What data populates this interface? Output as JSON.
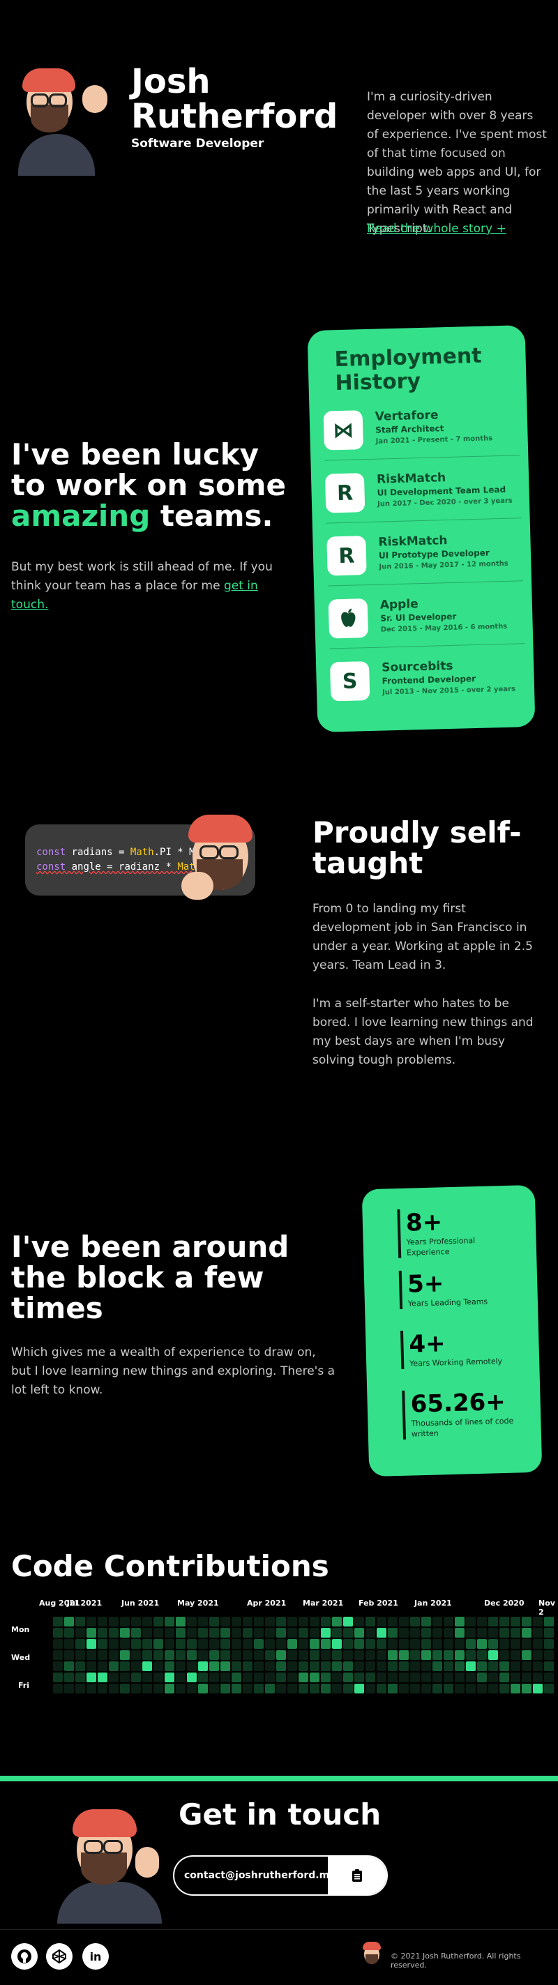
{
  "hero": {
    "first_name": "Josh",
    "last_name": "Rutherford",
    "subtitle": "Software Developer",
    "bio": "I'm a curiosity-driven developer with over 8 years of experience. I've spent most of that time focused on building web apps and UI, for the last 5 years working primarily with React and Typescript.",
    "story_link": "Read the whole story +"
  },
  "teams": {
    "line1": "I've been lucky",
    "line2": "to work on some",
    "highlight": "amazing",
    "line3_rest": " teams.",
    "body": "But my best work is still ahead of me. If you think your team has a place for me ",
    "cta": "get in touch."
  },
  "employment": {
    "title_line1": "Employment",
    "title_line2": "History",
    "jobs": [
      {
        "logo": "⋈",
        "company": "Vertafore",
        "role": "Staff Architect",
        "dates": "Jan 2021 - Present - 7 months"
      },
      {
        "logo": "R",
        "company": "RiskMatch",
        "role": "UI Development Team Lead",
        "dates": "Jun 2017 - Dec 2020 - over 3 years"
      },
      {
        "logo": "R",
        "company": "RiskMatch",
        "role": "UI Prototype Developer",
        "dates": "Jun 2016 - May 2017 - 12 months"
      },
      {
        "logo": "",
        "company": "Apple",
        "role": "Sr. UI Developer",
        "dates": "Dec 2015 - May 2016 - 6 months"
      },
      {
        "logo": "S",
        "company": "Sourcebits",
        "role": "Frontend Developer",
        "dates": "Jul 2013 - Nov 2015 - over 2 years"
      }
    ]
  },
  "selftaught": {
    "line1": "Proudly self-",
    "line2": "taught",
    "para1": "From 0 to landing my first development job in San Francisco in under a year. Working at apple in 2.5 years. Team Lead in 3.",
    "para2": "I'm a self-starter who hates to be bored. I love learning new things and my best days are when I'm busy solving tough problems.",
    "code_line1": {
      "kw": "const",
      "var": " radians = ",
      "cls": "Math",
      "rest": ".PI * M"
    },
    "code_line2": {
      "kw": "const",
      "var": " angle = radianz * ",
      "cls": "Mat",
      "rest": ""
    }
  },
  "experience": {
    "line1": "I've been around",
    "line2": "the block a few",
    "line3": "times",
    "body": "Which gives me a wealth of experience to draw on, but I love learning new things and exploring. There's a lot left to know.",
    "stats": [
      {
        "num": "8+",
        "label": "Years Professional Experience"
      },
      {
        "num": "5+",
        "label": "Years Leading Teams"
      },
      {
        "num": "4+",
        "label": "Years Working Remotely"
      },
      {
        "num": "65.26+",
        "label": "Thousands of lines of code written"
      }
    ]
  },
  "contributions": {
    "title": "Code Contributions",
    "months": [
      "Aug 2021",
      "Jul 2021",
      "Jun 2021",
      "May 2021",
      "Apr 2021",
      "Mar 2021",
      "Feb 2021",
      "Jan 2021",
      "Dec 2020",
      "Nov 2"
    ],
    "days": [
      "Mon",
      "Wed",
      "Fri"
    ],
    "colors": [
      "#0b1f14",
      "#0e3a22",
      "#135a33",
      "#1f8a4c",
      "#34e089"
    ]
  },
  "contact": {
    "title": "Get in touch",
    "email": "contact@joshrutherford.me"
  },
  "footer": {
    "social": [
      "github-icon",
      "codepen-icon",
      "linkedin-icon"
    ],
    "copyright": "© 2021 Josh Rutherford. All rights reserved."
  }
}
